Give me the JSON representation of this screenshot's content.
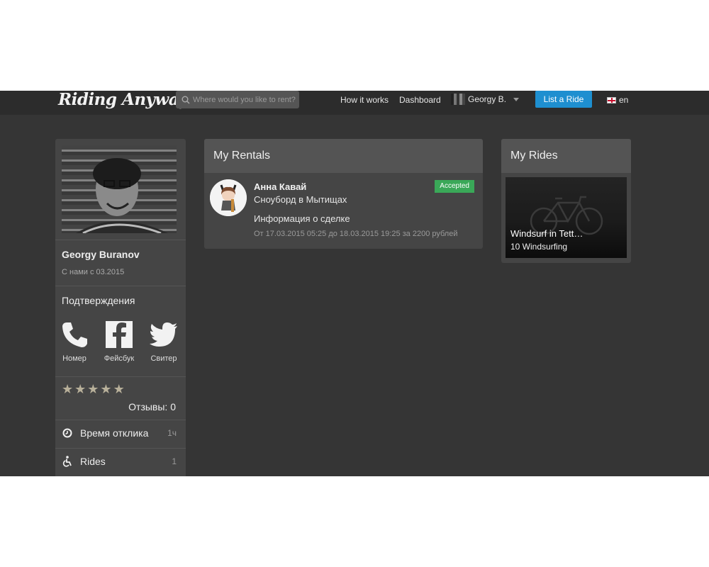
{
  "nav": {
    "logo": "Riding Anyway",
    "search_placeholder": "Where would you like to rent?",
    "how_it_works": "How it works",
    "dashboard": "Dashboard",
    "user_name": "Georgy B.",
    "list_ride": "List a Ride",
    "language": "en"
  },
  "profile": {
    "name": "Georgy Buranov",
    "member_since": "С нами с 03.2015",
    "verifications_title": "Подтверждения",
    "verifications": [
      {
        "label": "Номер",
        "icon": "phone-icon"
      },
      {
        "label": "Фейсбук",
        "icon": "facebook-icon"
      },
      {
        "label": "Свитер",
        "icon": "twitter-icon"
      }
    ],
    "rating_stars": 5,
    "reviews": "Отзывы: 0",
    "stats": [
      {
        "label": "Время отклика",
        "value": "1ч",
        "icon": "clock-icon"
      },
      {
        "label": "Rides",
        "value": "1",
        "icon": "accessibility-icon"
      }
    ]
  },
  "rentals": {
    "title": "My Rentals",
    "items": [
      {
        "owner": "Анна Кавай",
        "item": "Сноуборд в Мытищах",
        "info": "Информация о сделке",
        "dates": "От 17.03.2015 05:25 до 18.03.2015 19:25 за 2200 рублей",
        "status": "Accepted",
        "status_color": "#3aa858"
      }
    ]
  },
  "rides": {
    "title": "My Rides",
    "items": [
      {
        "title": "Windsurf in Tett…",
        "subtitle": "10 Windsurfing"
      }
    ]
  },
  "colors": {
    "background": "#353535",
    "nav": "#2c2c2c",
    "panel": "#454545",
    "accent": "#1e8fd0",
    "success": "#3aa858"
  }
}
